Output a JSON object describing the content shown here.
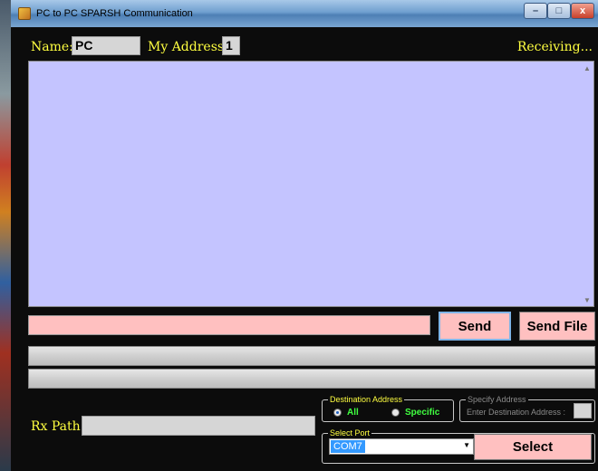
{
  "window": {
    "title": "PC to PC SPARSH Communication",
    "controls": {
      "minimize": "–",
      "maximize": "□",
      "close": "x"
    }
  },
  "header": {
    "name_label": "Name:",
    "name_value": "PC",
    "address_label": "My Address:",
    "address_value": "1",
    "status": "Receiving..."
  },
  "scroll": {
    "up": "▲",
    "down": "▼"
  },
  "send": {
    "input_value": "",
    "send_label": "Send",
    "send_file_label": "Send File"
  },
  "progress": {
    "tx": 0,
    "rx": 0
  },
  "bottom": {
    "rx_path_label": "Rx Path:",
    "rx_path_value": "",
    "destination": {
      "title": "Destination Address",
      "option_all": "All",
      "option_specific": "Specific",
      "selected": "All"
    },
    "specify": {
      "title": "Specify Address",
      "label": "Enter Destination Address :",
      "value": ""
    },
    "port": {
      "title": "Select Port",
      "selected": "COM7",
      "arrow": "▼"
    },
    "select_label": "Select"
  },
  "colors": {
    "label_yellow": "#ffff40",
    "radio_green": "#40ff40",
    "button_pink": "#ffc0c0",
    "receive_lavender": "#c4c4ff",
    "form_bg": "#0c0c0c"
  }
}
